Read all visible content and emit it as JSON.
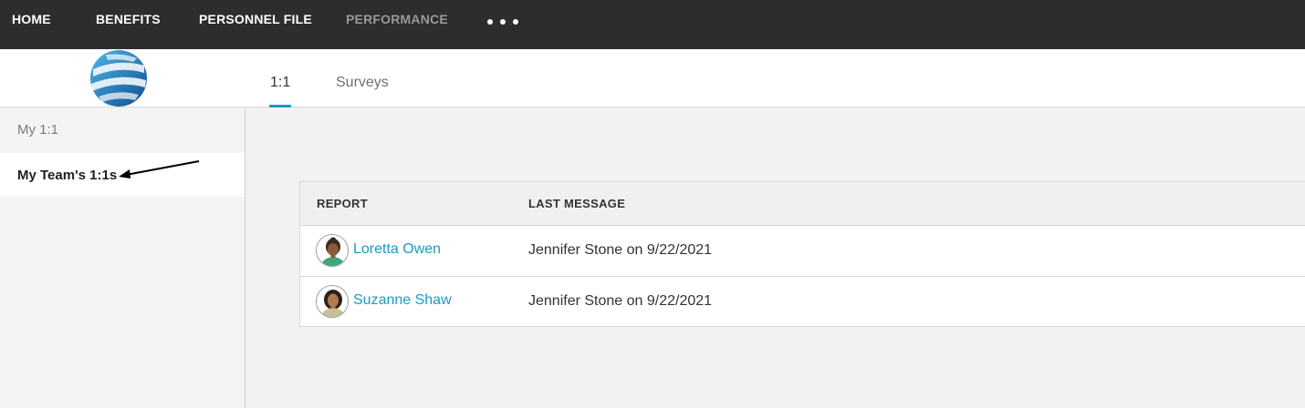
{
  "nav": {
    "items": [
      {
        "label": "HOME"
      },
      {
        "label": "BENEFITS"
      },
      {
        "label": "PERSONNEL FILE"
      },
      {
        "label": "PERFORMANCE"
      }
    ],
    "more_icon": "more-dots-icon"
  },
  "header": {
    "logo_icon": "globe-logo-icon",
    "tabs": [
      {
        "label": "1:1",
        "active": true
      },
      {
        "label": "Surveys",
        "active": false
      }
    ],
    "accent_color": "#1a9bc4"
  },
  "sidebar": {
    "items": [
      {
        "label": "My 1:1"
      },
      {
        "label": "My Team's 1:1s"
      }
    ]
  },
  "table": {
    "columns": [
      "REPORT",
      "LAST MESSAGE"
    ],
    "rows": [
      {
        "name": "Loretta Owen",
        "last_message": "Jennifer Stone on 9/22/2021",
        "avatar_icon": "female-avatar-icon"
      },
      {
        "name": "Suzanne Shaw",
        "last_message": "Jennifer Stone on 9/22/2021",
        "avatar_icon": "female-avatar-icon"
      }
    ]
  },
  "colors": {
    "nav_bg": "#2d2d2d",
    "link": "#1a9bc4"
  }
}
